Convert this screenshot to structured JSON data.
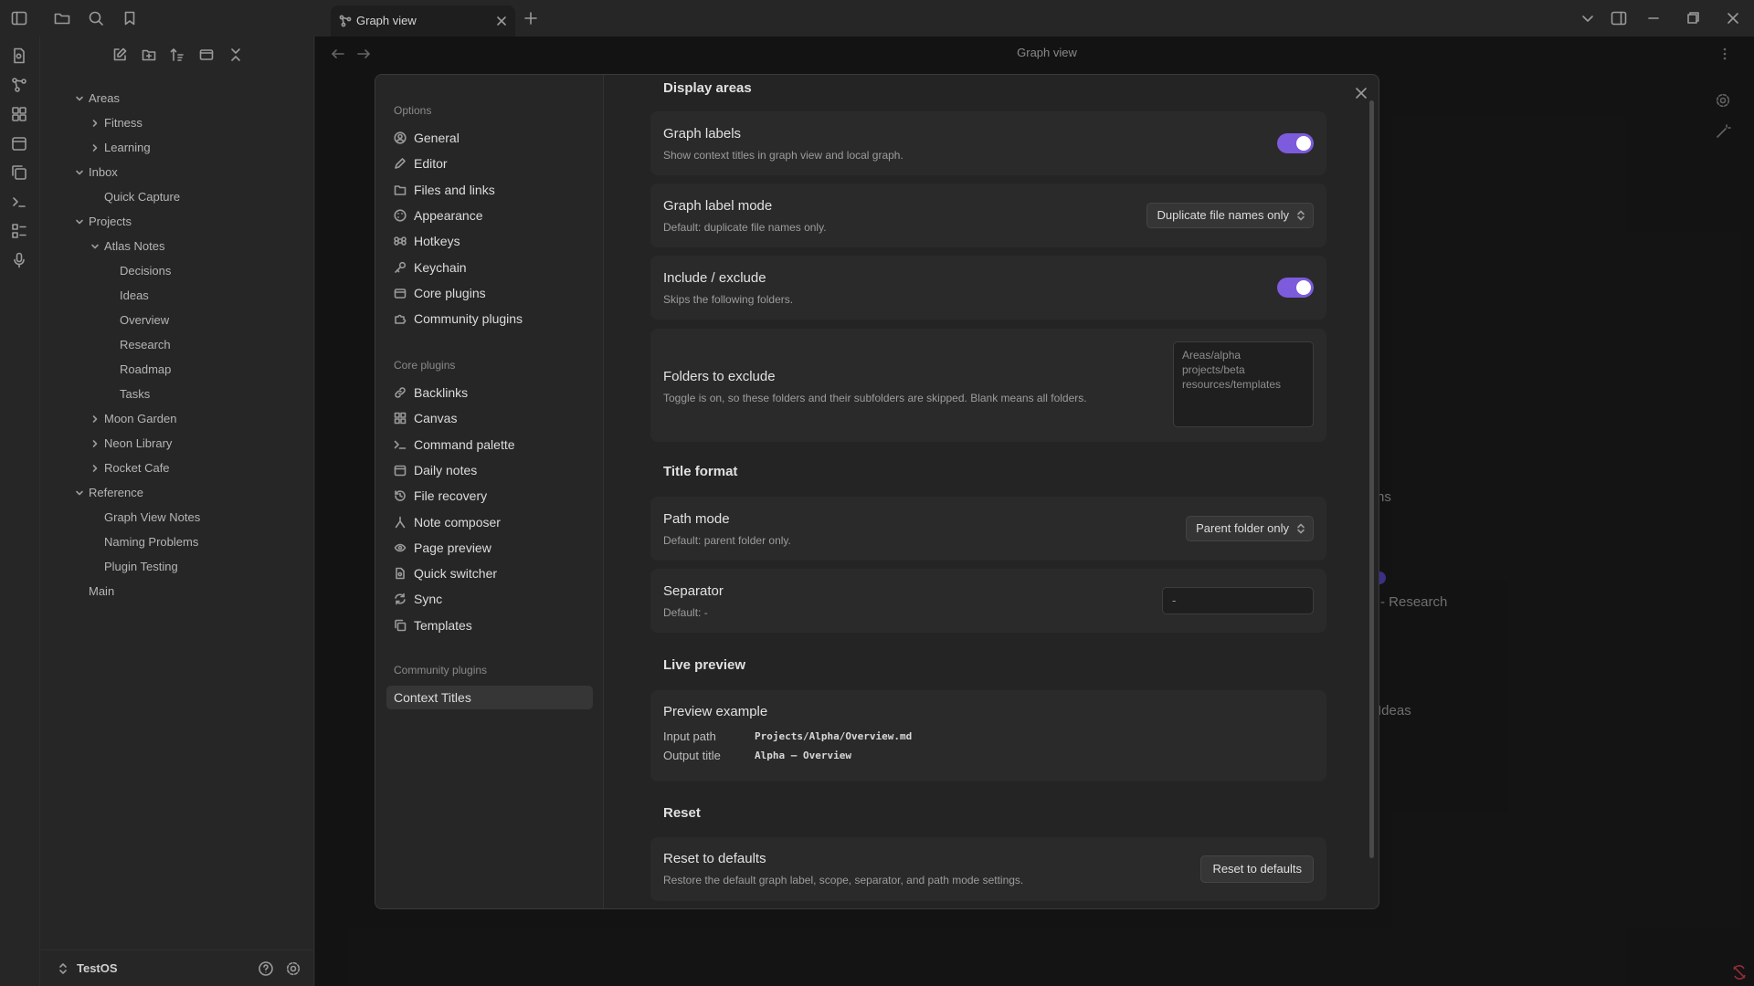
{
  "tab": {
    "title": "Graph view"
  },
  "view": {
    "title": "Graph view"
  },
  "graph": {
    "labels": [
      "ns",
      "- Research",
      "Ideas"
    ]
  },
  "sidebar": {
    "tree": [
      {
        "label": "Areas",
        "depth": 0,
        "state": "open"
      },
      {
        "label": "Fitness",
        "depth": 1,
        "state": "closed"
      },
      {
        "label": "Learning",
        "depth": 1,
        "state": "closed"
      },
      {
        "label": "Inbox",
        "depth": 0,
        "state": "open"
      },
      {
        "label": "Quick Capture",
        "depth": 1,
        "state": "file"
      },
      {
        "label": "Projects",
        "depth": 0,
        "state": "open"
      },
      {
        "label": "Atlas Notes",
        "depth": 1,
        "state": "open"
      },
      {
        "label": "Decisions",
        "depth": 2,
        "state": "file"
      },
      {
        "label": "Ideas",
        "depth": 2,
        "state": "file"
      },
      {
        "label": "Overview",
        "depth": 2,
        "state": "file"
      },
      {
        "label": "Research",
        "depth": 2,
        "state": "file"
      },
      {
        "label": "Roadmap",
        "depth": 2,
        "state": "file"
      },
      {
        "label": "Tasks",
        "depth": 2,
        "state": "file"
      },
      {
        "label": "Moon Garden",
        "depth": 1,
        "state": "closed"
      },
      {
        "label": "Neon Library",
        "depth": 1,
        "state": "closed"
      },
      {
        "label": "Rocket Cafe",
        "depth": 1,
        "state": "closed"
      },
      {
        "label": "Reference",
        "depth": 0,
        "state": "open"
      },
      {
        "label": "Graph View Notes",
        "depth": 1,
        "state": "file"
      },
      {
        "label": "Naming Problems",
        "depth": 1,
        "state": "file"
      },
      {
        "label": "Plugin Testing",
        "depth": 1,
        "state": "file"
      },
      {
        "label": "Main",
        "depth": 0,
        "state": "file"
      }
    ],
    "vault": "TestOS"
  },
  "settings_nav": {
    "options_heading": "Options",
    "options": [
      {
        "label": "General",
        "icon": "user-circle-icon"
      },
      {
        "label": "Editor",
        "icon": "pencil-icon"
      },
      {
        "label": "Files and links",
        "icon": "folder-link-icon"
      },
      {
        "label": "Appearance",
        "icon": "palette-icon"
      },
      {
        "label": "Hotkeys",
        "icon": "command-icon"
      },
      {
        "label": "Keychain",
        "icon": "key-icon"
      },
      {
        "label": "Core plugins",
        "icon": "plugin-icon"
      },
      {
        "label": "Community plugins",
        "icon": "puzzle-icon"
      }
    ],
    "core_heading": "Core plugins",
    "core": [
      {
        "label": "Backlinks",
        "icon": "link-icon"
      },
      {
        "label": "Canvas",
        "icon": "grid-icon"
      },
      {
        "label": "Command palette",
        "icon": "terminal-icon"
      },
      {
        "label": "Daily notes",
        "icon": "calendar-icon"
      },
      {
        "label": "File recovery",
        "icon": "history-icon"
      },
      {
        "label": "Note composer",
        "icon": "merge-icon"
      },
      {
        "label": "Page preview",
        "icon": "eye-scan-icon"
      },
      {
        "label": "Quick switcher",
        "icon": "file-search-icon"
      },
      {
        "label": "Sync",
        "icon": "sync-icon"
      },
      {
        "label": "Templates",
        "icon": "copy-icon"
      }
    ],
    "community_heading": "Community plugins",
    "community": [
      {
        "label": "Context Titles",
        "active": true
      }
    ]
  },
  "content": {
    "display_areas": {
      "title": "Display areas",
      "graph_labels": {
        "name": "Graph labels",
        "desc": "Show context titles in graph view and local graph.",
        "enabled": true
      },
      "graph_label_mode": {
        "name": "Graph label mode",
        "desc": "Default: duplicate file names only.",
        "value": "Duplicate file names only"
      },
      "include_exclude": {
        "name": "Include / exclude",
        "desc": "Skips the following folders.",
        "enabled": true
      },
      "folders_to_exclude": {
        "name": "Folders to exclude",
        "desc": "Toggle is on, so these folders and their subfolders are skipped. Blank means all folders.",
        "placeholder": "Areas/alpha\nprojects/beta\nresources/templates"
      }
    },
    "title_format": {
      "title": "Title format",
      "path_mode": {
        "name": "Path mode",
        "desc": "Default: parent folder only.",
        "value": "Parent folder only"
      },
      "separator": {
        "name": "Separator",
        "desc": "Default: -",
        "value": "-"
      }
    },
    "live_preview": {
      "title": "Live preview",
      "name": "Preview example",
      "input_label": "Input path",
      "input_value": "Projects/Alpha/Overview.md",
      "output_label": "Output title",
      "output_value": "Alpha – Overview"
    },
    "reset": {
      "title": "Reset",
      "name": "Reset to defaults",
      "desc": "Restore the default graph label, scope, separator, and path mode settings.",
      "button": "Reset to defaults"
    }
  },
  "colors": {
    "accent": "#7c5bdc",
    "background": "#1e1e1e",
    "panel": "#262626",
    "card": "#2a2a2a"
  }
}
